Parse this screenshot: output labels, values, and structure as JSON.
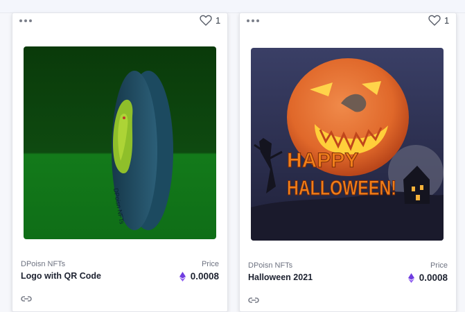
{
  "cards": [
    {
      "likes": "1",
      "creator": "DPoisn NFTs",
      "title": "Logo with QR Code",
      "price_label": "Price",
      "price": "0.0008",
      "art": {
        "coin_text": "DPoisn NFTs"
      }
    },
    {
      "likes": "1",
      "creator": "DPoisn NFTs",
      "title": "Halloween 2021",
      "price_label": "Price",
      "price": "0.0008",
      "art": {
        "text_line1": "HAPPY",
        "text_line2": "HALLOWEEN!"
      }
    }
  ],
  "colors": {
    "eth": "#6f3ce0",
    "card_bg": "#ffffff",
    "text_primary": "#1d2230",
    "text_secondary": "#6d7280"
  }
}
